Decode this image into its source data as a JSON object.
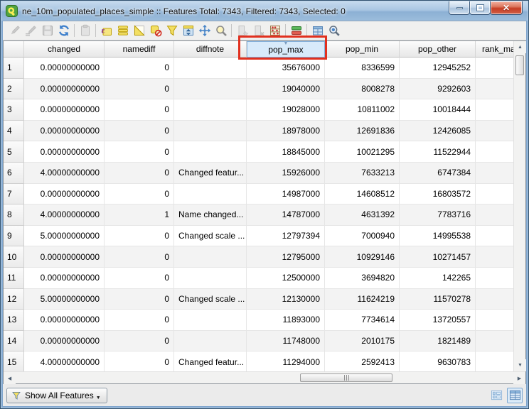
{
  "window": {
    "title": "ne_10m_populated_places_simple :: Features Total: 7343, Filtered: 7343, Selected: 0"
  },
  "toolbar": {
    "items": [
      {
        "icon": "pencil",
        "name": "toggle-editing",
        "enabled": false
      },
      {
        "icon": "pencil2",
        "name": "multi-edit",
        "enabled": false
      },
      {
        "icon": "save",
        "name": "save-edits",
        "enabled": false
      },
      {
        "icon": "refresh",
        "name": "reload-table",
        "enabled": true
      },
      {
        "sep": true
      },
      {
        "icon": "clipboard",
        "name": "paste-features",
        "enabled": false
      },
      {
        "sep": true
      },
      {
        "icon": "expression",
        "name": "select-by-expression",
        "enabled": true
      },
      {
        "icon": "selectall",
        "name": "select-all",
        "enabled": true
      },
      {
        "icon": "invert",
        "name": "invert-selection",
        "enabled": true
      },
      {
        "icon": "deselect",
        "name": "deselect-all",
        "enabled": true
      },
      {
        "icon": "funnel",
        "name": "filter-select",
        "enabled": true
      },
      {
        "icon": "movetop",
        "name": "move-selection-to-top",
        "enabled": true
      },
      {
        "icon": "pan",
        "name": "pan-to-selection",
        "enabled": true
      },
      {
        "icon": "zoomsel",
        "name": "zoom-to-selection",
        "enabled": true
      },
      {
        "sep": true
      },
      {
        "icon": "newfield",
        "name": "new-field",
        "enabled": false
      },
      {
        "icon": "delfield",
        "name": "delete-field",
        "enabled": false
      },
      {
        "icon": "calculator",
        "name": "field-calculator",
        "enabled": true
      },
      {
        "sep": true
      },
      {
        "icon": "condformat",
        "name": "conditional-formatting",
        "enabled": true
      },
      {
        "sep": true
      },
      {
        "icon": "docktable",
        "name": "dock-attribute-table",
        "enabled": true
      },
      {
        "icon": "search",
        "name": "search-widget",
        "enabled": true
      }
    ]
  },
  "table": {
    "columns": [
      "",
      "changed",
      "namediff",
      "diffnote",
      "pop_max",
      "pop_min",
      "pop_other",
      "rank_max"
    ],
    "selected_column": "pop_max",
    "sort_indicator": "▼",
    "rows": [
      {
        "n": "1",
        "changed": "0.00000000000",
        "namediff": "0",
        "diffnote": "",
        "pop_max": "35676000",
        "pop_min": "8336599",
        "pop_other": "12945252",
        "rank_max": ""
      },
      {
        "n": "2",
        "changed": "0.00000000000",
        "namediff": "0",
        "diffnote": "",
        "pop_max": "19040000",
        "pop_min": "8008278",
        "pop_other": "9292603",
        "rank_max": ""
      },
      {
        "n": "3",
        "changed": "0.00000000000",
        "namediff": "0",
        "diffnote": "",
        "pop_max": "19028000",
        "pop_min": "10811002",
        "pop_other": "10018444",
        "rank_max": ""
      },
      {
        "n": "4",
        "changed": "0.00000000000",
        "namediff": "0",
        "diffnote": "",
        "pop_max": "18978000",
        "pop_min": "12691836",
        "pop_other": "12426085",
        "rank_max": ""
      },
      {
        "n": "5",
        "changed": "0.00000000000",
        "namediff": "0",
        "diffnote": "",
        "pop_max": "18845000",
        "pop_min": "10021295",
        "pop_other": "11522944",
        "rank_max": ""
      },
      {
        "n": "6",
        "changed": "4.00000000000",
        "namediff": "0",
        "diffnote": "Changed featur...",
        "pop_max": "15926000",
        "pop_min": "7633213",
        "pop_other": "6747384",
        "rank_max": ""
      },
      {
        "n": "7",
        "changed": "0.00000000000",
        "namediff": "0",
        "diffnote": "",
        "pop_max": "14987000",
        "pop_min": "14608512",
        "pop_other": "16803572",
        "rank_max": ""
      },
      {
        "n": "8",
        "changed": "4.00000000000",
        "namediff": "1",
        "diffnote": "Name changed...",
        "pop_max": "14787000",
        "pop_min": "4631392",
        "pop_other": "7783716",
        "rank_max": ""
      },
      {
        "n": "9",
        "changed": "5.00000000000",
        "namediff": "0",
        "diffnote": "Changed scale ...",
        "pop_max": "12797394",
        "pop_min": "7000940",
        "pop_other": "14995538",
        "rank_max": ""
      },
      {
        "n": "10",
        "changed": "0.00000000000",
        "namediff": "0",
        "diffnote": "",
        "pop_max": "12795000",
        "pop_min": "10929146",
        "pop_other": "10271457",
        "rank_max": ""
      },
      {
        "n": "11",
        "changed": "0.00000000000",
        "namediff": "0",
        "diffnote": "",
        "pop_max": "12500000",
        "pop_min": "3694820",
        "pop_other": "142265",
        "rank_max": ""
      },
      {
        "n": "12",
        "changed": "5.00000000000",
        "namediff": "0",
        "diffnote": "Changed scale ...",
        "pop_max": "12130000",
        "pop_min": "11624219",
        "pop_other": "11570278",
        "rank_max": ""
      },
      {
        "n": "13",
        "changed": "0.00000000000",
        "namediff": "0",
        "diffnote": "",
        "pop_max": "11893000",
        "pop_min": "7734614",
        "pop_other": "13720557",
        "rank_max": ""
      },
      {
        "n": "14",
        "changed": "0.00000000000",
        "namediff": "0",
        "diffnote": "",
        "pop_max": "11748000",
        "pop_min": "2010175",
        "pop_other": "1821489",
        "rank_max": ""
      },
      {
        "n": "15",
        "changed": "4.00000000000",
        "namediff": "0",
        "diffnote": "Changed featur...",
        "pop_max": "11294000",
        "pop_min": "2592413",
        "pop_other": "9630783",
        "rank_max": ""
      }
    ]
  },
  "annotation": {
    "target": "pop_max-column-header",
    "color": "#e1301f"
  },
  "statusbar": {
    "show_all_features": "Show All Features"
  }
}
